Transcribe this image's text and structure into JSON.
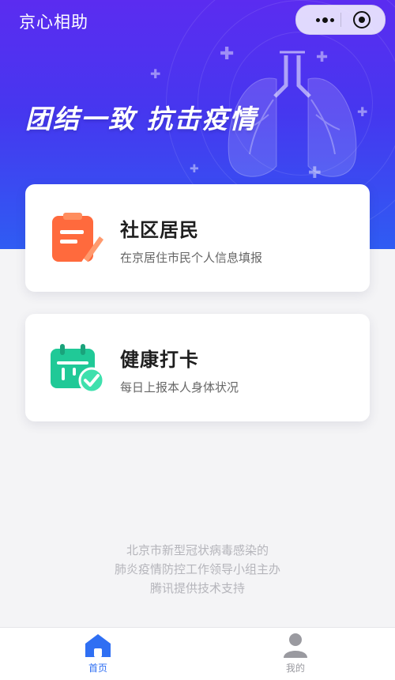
{
  "app": {
    "title": "京心相助"
  },
  "capsule": {
    "more_icon": "more-dots-icon",
    "close_icon": "mini-program-close-icon"
  },
  "hero": {
    "slogan": "团结一致 抗击疫情",
    "colors": {
      "top": "#5b2cf0",
      "bottom": "#2f5cf3"
    }
  },
  "cards": [
    {
      "title": "社区居民",
      "subtitle": "在京居住市民个人信息填报",
      "icon": "clipboard-form-icon",
      "color": "#ff6a3d"
    },
    {
      "title": "健康打卡",
      "subtitle": "每日上报本人身体状况",
      "icon": "calendar-check-icon",
      "color": "#20c997"
    }
  ],
  "footer": {
    "lines": [
      "北京市新型冠状病毒感染的",
      "肺炎疫情防控工作领导小组主办",
      "腾讯提供技术支持"
    ]
  },
  "tabbar": {
    "items": [
      {
        "label": "首页",
        "icon": "home-icon",
        "active": true,
        "color": "#2f6ff3"
      },
      {
        "label": "我的",
        "icon": "user-icon",
        "active": false,
        "color": "#9a9aa0"
      }
    ]
  }
}
